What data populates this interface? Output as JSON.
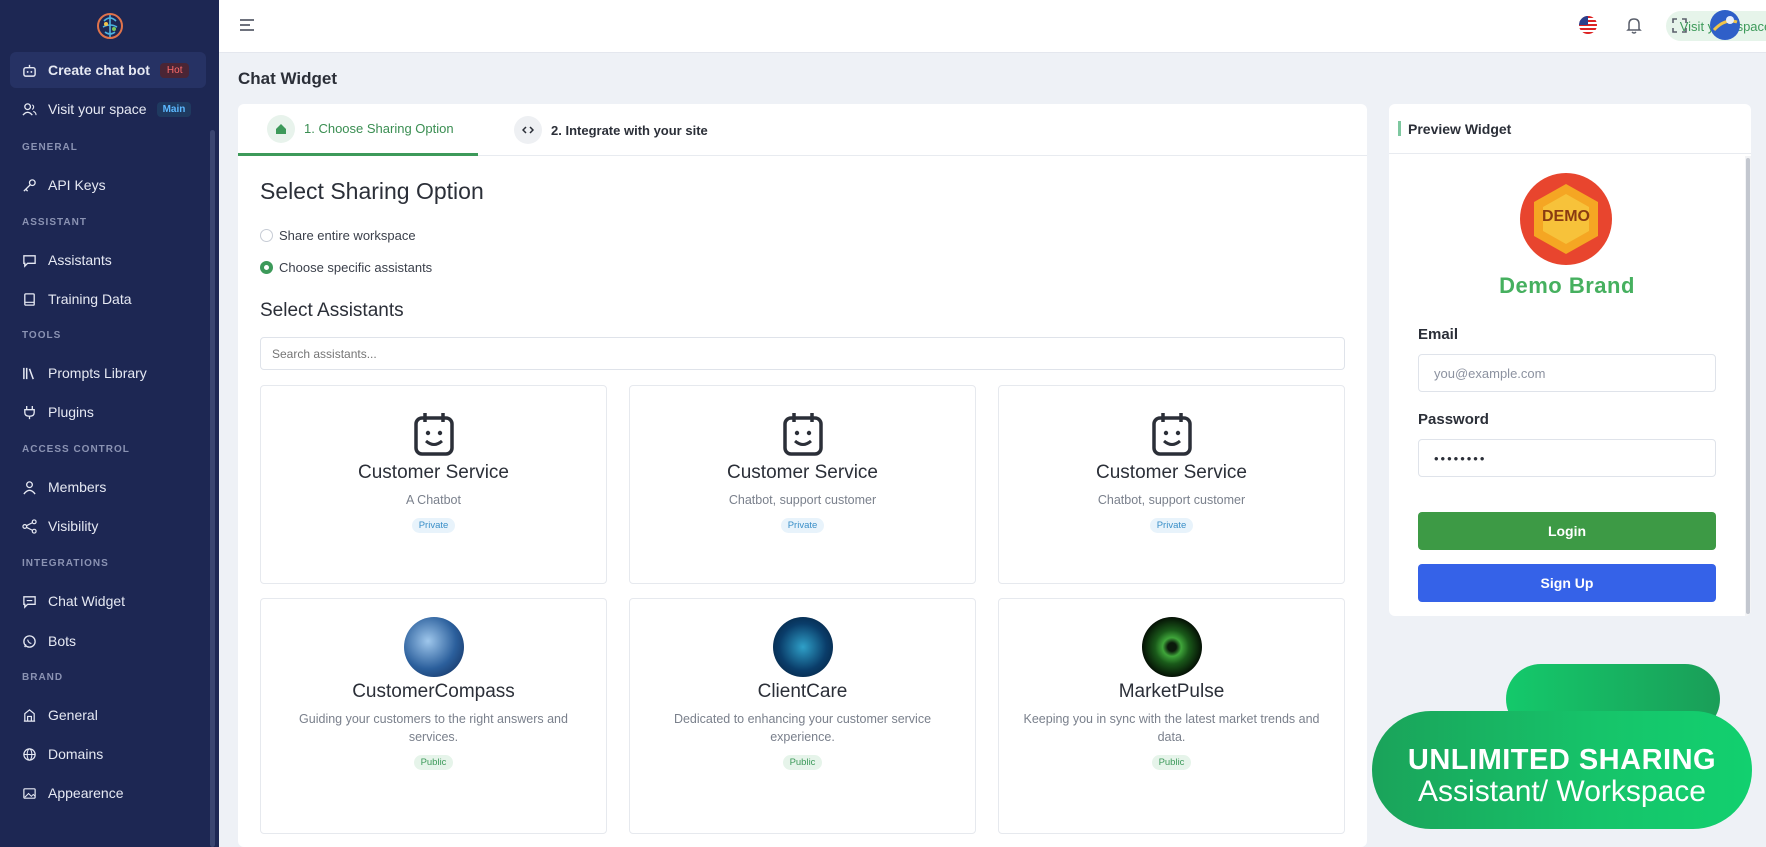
{
  "sidebar": {
    "sections": {
      "general": "GENERAL",
      "assistant": "ASSISTANT",
      "tools": "TOOLS",
      "access": "ACCESS CONTROL",
      "integrations": "INTEGRATIONS",
      "brand": "BRAND"
    },
    "items": {
      "create_bot": {
        "label": "Create chat bot",
        "badge": "Hot"
      },
      "visit_space": {
        "label": "Visit your space",
        "badge": "Main"
      },
      "api_keys": "API Keys",
      "assistants": "Assistants",
      "training": "Training Data",
      "prompts": "Prompts Library",
      "plugins": "Plugins",
      "members": "Members",
      "visibility": "Visibility",
      "chat_widget": "Chat Widget",
      "bots": "Bots",
      "general": "General",
      "domains": "Domains",
      "appearence": "Appearence"
    }
  },
  "header": {
    "visit_label": "Visit your space"
  },
  "page": {
    "title": "Chat Widget",
    "tabs": {
      "tab1": "1. Choose Sharing Option",
      "tab2": "2. Integrate with your site"
    },
    "sharing_heading": "Select Sharing Option",
    "options": {
      "opt1": "Share entire workspace",
      "opt2": "Choose specific assistants",
      "selected": "opt2"
    },
    "assistants_heading": "Select Assistants",
    "search_placeholder": "Search assistants...",
    "assistants": [
      {
        "name": "Customer Service",
        "desc": "A Chatbot",
        "badge": "Private"
      },
      {
        "name": "Customer Service",
        "desc": "Chatbot, support customer",
        "badge": "Private"
      },
      {
        "name": "Customer Service",
        "desc": "Chatbot, support customer",
        "badge": "Private"
      },
      {
        "name": "CustomerCompass",
        "desc": "Guiding your customers to the right answers and services.",
        "badge": "Public"
      },
      {
        "name": "ClientCare",
        "desc": "Dedicated to enhancing your customer service experience.",
        "badge": "Public"
      },
      {
        "name": "MarketPulse",
        "desc": "Keeping you in sync with the latest market trends and data.",
        "badge": "Public"
      }
    ]
  },
  "preview": {
    "title": "Preview Widget",
    "logo_text": "DEMO",
    "brand": "Demo Brand",
    "email_label": "Email",
    "email_placeholder": "you@example.com",
    "password_label": "Password",
    "password_value": "••••••••",
    "login": "Login",
    "signup": "Sign Up"
  },
  "promo": {
    "line1": "UNLIMITED SHARING",
    "line2": "Assistant/ Workspace"
  },
  "colors": {
    "sidebar": "#1d2753",
    "accent_green": "#3d9a5a",
    "signup_blue": "#3562e8",
    "brand_green": "#46b05f"
  }
}
